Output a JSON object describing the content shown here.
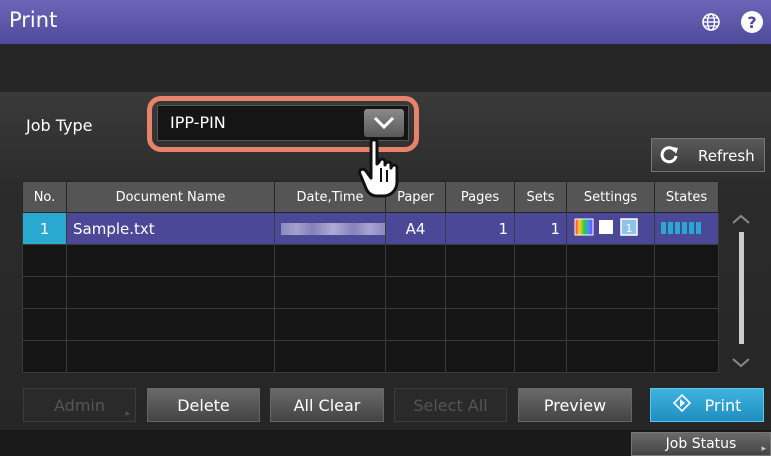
{
  "header": {
    "title": "Print",
    "globe_icon": "globe-icon",
    "help_icon": "help-icon"
  },
  "job_type": {
    "label": "Job Type",
    "value": "IPP-PIN"
  },
  "refresh": {
    "label": "Refresh"
  },
  "table": {
    "headers": {
      "no": "No.",
      "document": "Document Name",
      "date": "Date,Time",
      "paper": "Paper",
      "pages": "Pages",
      "sets": "Sets",
      "settings": "Settings",
      "states": "States"
    },
    "rows": [
      {
        "no": "1",
        "document": "Sample.txt",
        "paper": "A4",
        "pages": "1",
        "sets": "1",
        "settings_copies": "1"
      }
    ]
  },
  "buttons": {
    "admin": "Admin",
    "delete": "Delete",
    "all_clear": "All Clear",
    "select_all": "Select All",
    "preview": "Preview",
    "print": "Print"
  },
  "footer": {
    "job_status": "Job Status"
  },
  "colors": {
    "title_bar": "#5a56aa",
    "selected_row": "#4b4898",
    "accent": "#2aa9d0",
    "highlight": "#e8826a"
  }
}
